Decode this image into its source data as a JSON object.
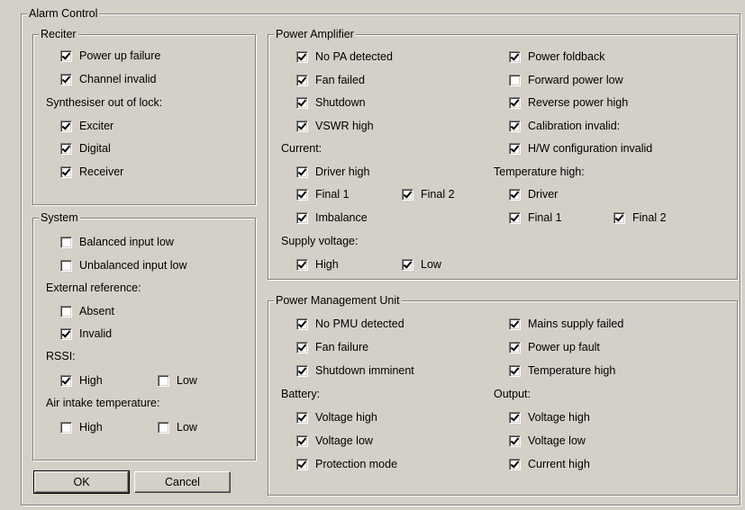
{
  "alarm_control": {
    "title": "Alarm Control"
  },
  "reciter": {
    "title": "Reciter",
    "power_up_failure": {
      "label": "Power up failure",
      "checked": true
    },
    "channel_invalid": {
      "label": "Channel invalid",
      "checked": true
    },
    "synth_heading": "Synthesiser out of lock:",
    "exciter": {
      "label": "Exciter",
      "checked": true
    },
    "digital": {
      "label": "Digital",
      "checked": true
    },
    "receiver": {
      "label": "Receiver",
      "checked": true
    }
  },
  "system": {
    "title": "System",
    "balanced_input_low": {
      "label": "Balanced input low",
      "checked": false
    },
    "unbalanced_input_low": {
      "label": "Unbalanced input low",
      "checked": false
    },
    "ext_ref_heading": "External reference:",
    "absent": {
      "label": "Absent",
      "checked": false
    },
    "invalid": {
      "label": "Invalid",
      "checked": true
    },
    "rssi_heading": "RSSI:",
    "rssi_high": {
      "label": "High",
      "checked": true
    },
    "rssi_low": {
      "label": "Low",
      "checked": false
    },
    "air_heading": "Air intake temperature:",
    "air_high": {
      "label": "High",
      "checked": false
    },
    "air_low": {
      "label": "Low",
      "checked": false
    }
  },
  "power_amplifier": {
    "title": "Power Amplifier",
    "no_pa_detected": {
      "label": "No PA detected",
      "checked": true
    },
    "fan_failed": {
      "label": "Fan failed",
      "checked": true
    },
    "shutdown": {
      "label": "Shutdown",
      "checked": true
    },
    "vswr_high": {
      "label": "VSWR high",
      "checked": true
    },
    "current_heading": "Current:",
    "driver_high": {
      "label": "Driver high",
      "checked": true
    },
    "final1": {
      "label": "Final 1",
      "checked": true
    },
    "final2": {
      "label": "Final 2",
      "checked": true
    },
    "imbalance": {
      "label": "Imbalance",
      "checked": true
    },
    "supply_heading": "Supply voltage:",
    "supply_high": {
      "label": "High",
      "checked": true
    },
    "supply_low": {
      "label": "Low",
      "checked": true
    },
    "power_foldback": {
      "label": "Power foldback",
      "checked": true
    },
    "forward_power_low": {
      "label": "Forward power low",
      "checked": false
    },
    "reverse_power_high": {
      "label": "Reverse power high",
      "checked": true
    },
    "calibration_invalid": {
      "label": "Calibration invalid:",
      "checked": true
    },
    "hw_config_invalid": {
      "label": "H/W configuration invalid",
      "checked": true
    },
    "temp_heading": "Temperature high:",
    "temp_driver": {
      "label": "Driver",
      "checked": true
    },
    "temp_final1": {
      "label": "Final 1",
      "checked": true
    },
    "temp_final2": {
      "label": "Final 2",
      "checked": true
    }
  },
  "pmu": {
    "title": "Power Management Unit",
    "no_pmu_detected": {
      "label": "No PMU detected",
      "checked": true
    },
    "fan_failure": {
      "label": "Fan failure",
      "checked": true
    },
    "shutdown_imminent": {
      "label": "Shutdown imminent",
      "checked": true
    },
    "battery_heading": "Battery:",
    "bat_voltage_high": {
      "label": "Voltage high",
      "checked": true
    },
    "bat_voltage_low": {
      "label": "Voltage low",
      "checked": true
    },
    "protection_mode": {
      "label": "Protection mode",
      "checked": true
    },
    "mains_supply_failed": {
      "label": "Mains supply failed",
      "checked": true
    },
    "power_up_fault": {
      "label": "Power up fault",
      "checked": true
    },
    "temperature_high": {
      "label": "Temperature high",
      "checked": true
    },
    "output_heading": "Output:",
    "out_voltage_high": {
      "label": "Voltage high",
      "checked": true
    },
    "out_voltage_low": {
      "label": "Voltage low",
      "checked": true
    },
    "out_current_high": {
      "label": "Current high",
      "checked": true
    }
  },
  "buttons": {
    "ok": "OK",
    "cancel": "Cancel"
  }
}
